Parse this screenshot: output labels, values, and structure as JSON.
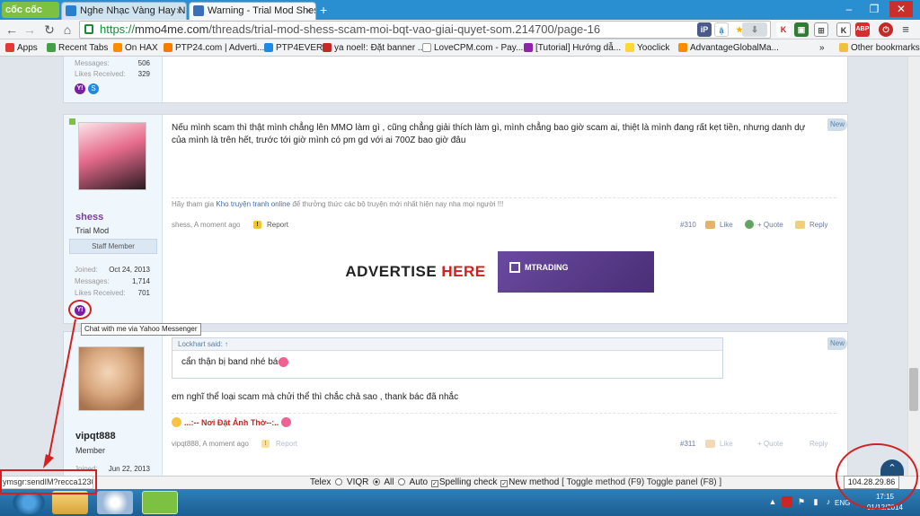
{
  "browser": {
    "brand": "cốc cốc",
    "tabs": [
      {
        "title": "Nghe Nhạc Vàng Hay N",
        "active": false,
        "favicon_color": "#2a7fcf"
      },
      {
        "title": "Warning - Trial Mod Shess",
        "active": true,
        "favicon_color": "#3b6fb6"
      }
    ],
    "url": {
      "scheme": "https://",
      "host": "mmo4me.com",
      "path": "/threads/trial-mod-shess-scam-moi-bqt-vao-giai-quyet-som.214700/page-16"
    },
    "bookmarks": [
      {
        "label": "Apps",
        "icon_color": "#e53935"
      },
      {
        "label": "Recent Tabs",
        "icon_color": "#43a047"
      },
      {
        "label": "On HAX",
        "icon_color": "#fb8c00"
      },
      {
        "label": "PTP24.com | Adverti...",
        "icon_color": "#f57c00"
      },
      {
        "label": "PTP4EVER",
        "icon_color": "#1e88e5"
      },
      {
        "label": "ya noel!: Đặt banner ...",
        "icon_color": "#c62828"
      },
      {
        "label": "LoveCPM.com - Pay...",
        "icon_color": "#ffffff"
      },
      {
        "label": "[Tutorial] Hướng dẫ...",
        "icon_color": "#8e24aa"
      },
      {
        "label": "Yooclick",
        "icon_color": "#fdd835"
      },
      {
        "label": "AdvantageGlobalMa...",
        "icon_color": "#fb8c00"
      }
    ],
    "bookmarks_more": "»",
    "other_bookmarks": "Other bookmarks"
  },
  "posts": {
    "prev_stats": {
      "messages_label": "Messages:",
      "messages": "506",
      "likes_label": "Likes Received:",
      "likes": "329"
    },
    "post310": {
      "username": "shess",
      "user_title": "Trial Mod",
      "banner": "Staff Member",
      "joined_label": "Joined:",
      "joined": "Oct 24, 2013",
      "messages_label": "Messages:",
      "messages": "1,714",
      "likes_label": "Likes Received:",
      "likes": "701",
      "body": "Nếu mình scam thì thật mình chẳng lên MMO làm gì , cũng chẳng giải thích làm gì, mình chẳng bao giờ scam ai, thiệt là mình đang rất kẹt tiền, nhưng danh dự của mình là trên hết, trước tới giờ mình có pm gd với ai 700Z bao giờ đâu",
      "signature_pre": "Hãy tham gia ",
      "signature_link": "Kho truyện tranh online",
      "signature_post": " để thưởng thức các bộ truyện mới nhất hiện nay nha mọi người !!!",
      "author_time": "shess, A moment ago",
      "report": "Report",
      "number": "#310",
      "like": "Like",
      "quote": "+ Quote",
      "reply": "Reply",
      "badge": "New"
    },
    "ads": {
      "left": "ADVERTISE HERE",
      "right": "MTRADING"
    },
    "tooltip": "Chat with me via Yahoo Messenger",
    "post311": {
      "username": "vipqt888",
      "user_title": "Member",
      "joined_label": "Joined:",
      "joined": "Jun 22, 2013",
      "quote_author": "Lockhart said: ↑",
      "quote_text": "cẩn thận bị band nhé bác",
      "body": "em nghĩ thể loại scam mà chửi thể thì chắc chả sao , thank bác đã nhắc",
      "signature": "...:-- Nơi Đặt Ảnh Thờ--:..",
      "author_time": "vipqt888, A moment ago",
      "report": "Report",
      "number": "#311",
      "like": "Like",
      "quote": "+ Quote",
      "reply": "Reply",
      "badge": "New"
    }
  },
  "status": {
    "url": "ymsgr:sendIM?recca1230",
    "ip": "104.28.29.86"
  },
  "ime": {
    "telex": "Telex",
    "viqr": "VIQR",
    "all": "All",
    "auto": "Auto",
    "spelling": "Spelling check",
    "newmethod": "New method",
    "toggle": "[ Toggle method (F9) Toggle panel (F8) ]"
  },
  "taskbar": {
    "lang": "ENG",
    "time": "17:15",
    "date": "01/12/2014"
  },
  "colors": {
    "tab_bar": "#2a8fd0",
    "brand_green": "#7cc142",
    "username_purple": "#7b3aa8",
    "annotation_red": "#d32020"
  }
}
